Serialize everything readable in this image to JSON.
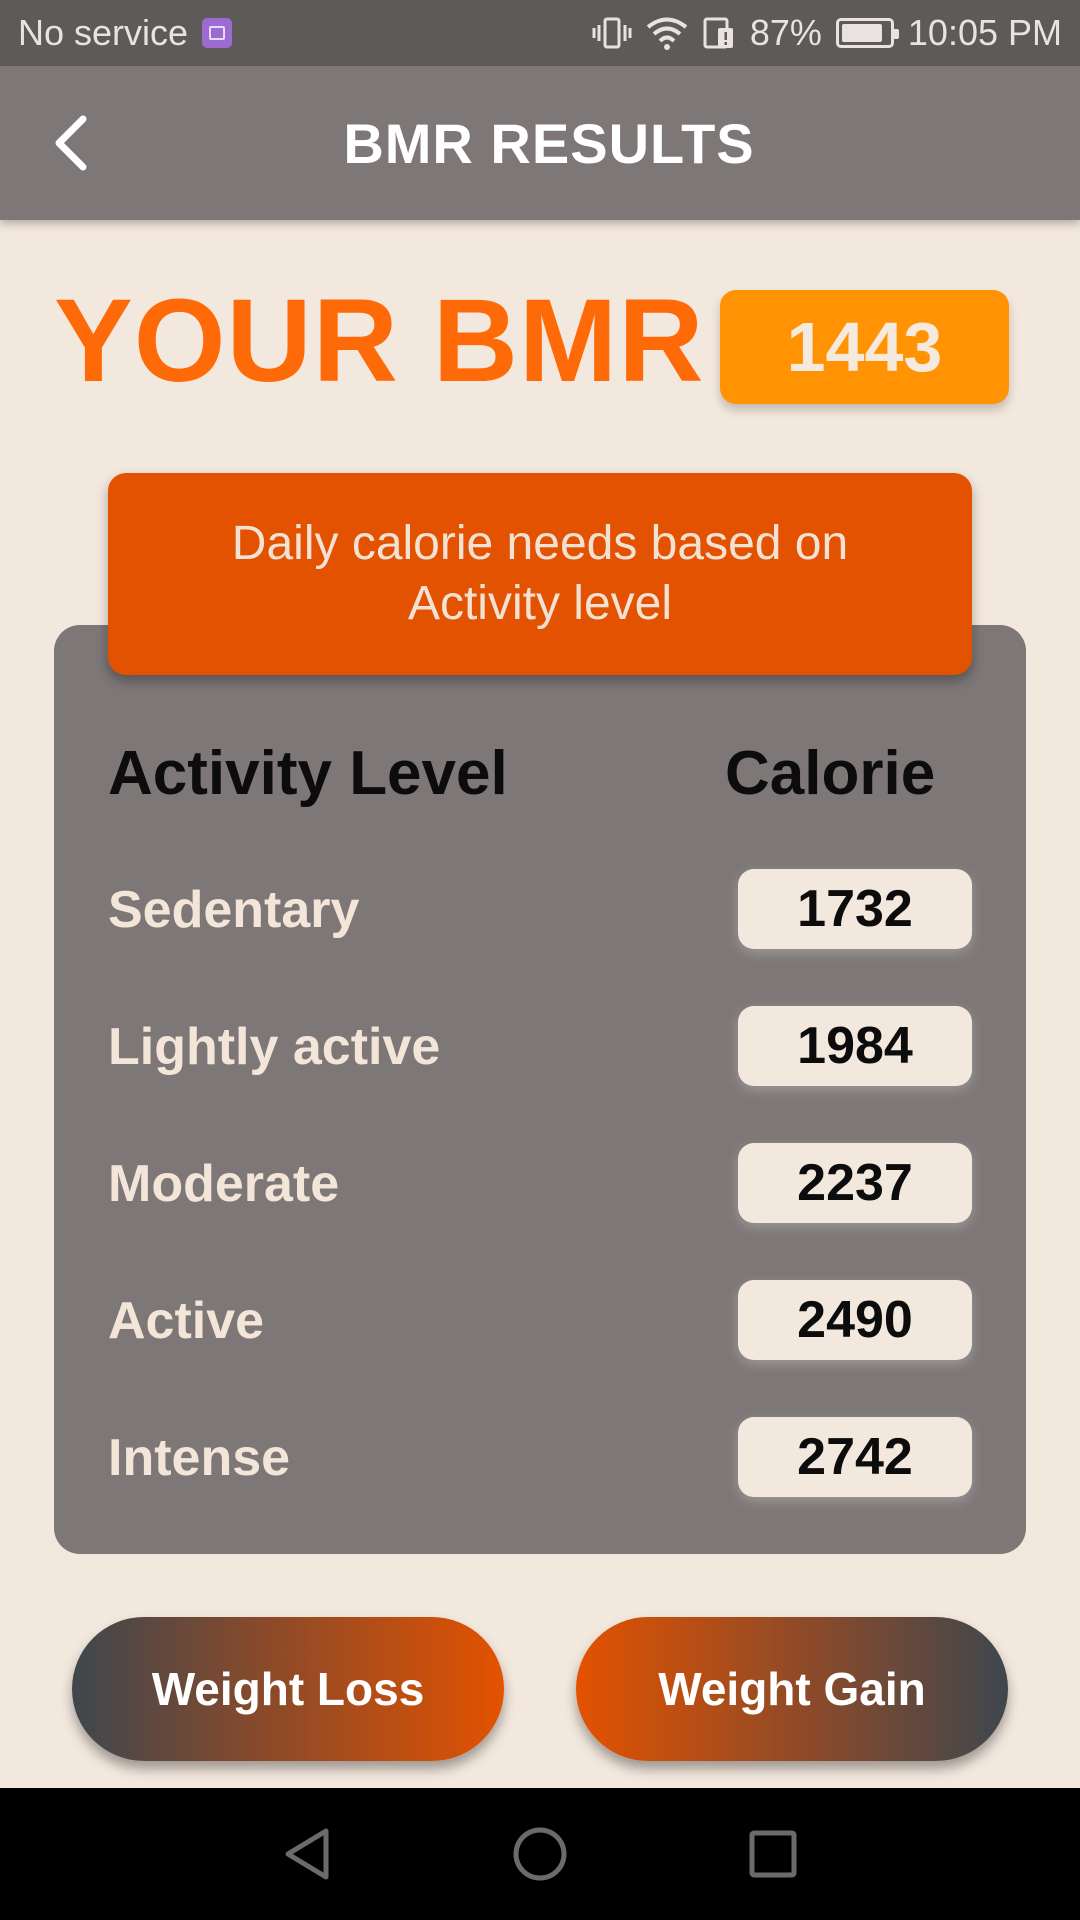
{
  "status_bar": {
    "carrier": "No service",
    "battery_percent": "87%",
    "battery_level": 0.87,
    "time": "10:05 PM",
    "icons": [
      "sim-card-icon",
      "vibrate-icon",
      "wifi-icon",
      "data-alert-icon",
      "battery-icon"
    ]
  },
  "app_bar": {
    "title": "BMR RESULTS",
    "back_icon": "chevron-left-icon"
  },
  "bmr": {
    "label": "YOUR BMR",
    "value": "1443"
  },
  "card": {
    "banner_line1": "Daily calorie needs based on",
    "banner_line2": "Activity level",
    "column_activity": "Activity Level",
    "column_calorie": "Calorie",
    "rows": [
      {
        "label": "Sedentary",
        "value": "1732"
      },
      {
        "label": "Lightly active",
        "value": "1984"
      },
      {
        "label": "Moderate",
        "value": "2237"
      },
      {
        "label": "Active",
        "value": "2490"
      },
      {
        "label": "Intense",
        "value": "2742"
      }
    ]
  },
  "buttons": {
    "weight_loss": "Weight Loss",
    "weight_gain": "Weight Gain"
  },
  "colors": {
    "accent_orange": "#ff6a08",
    "bmr_badge": "#ff9304",
    "banner": "#e35200",
    "card_gray": "#7d7777",
    "background": "#f3e8de"
  },
  "nav_bar": {
    "icons": [
      "back-triangle-icon",
      "home-circle-icon",
      "recents-square-icon"
    ]
  }
}
